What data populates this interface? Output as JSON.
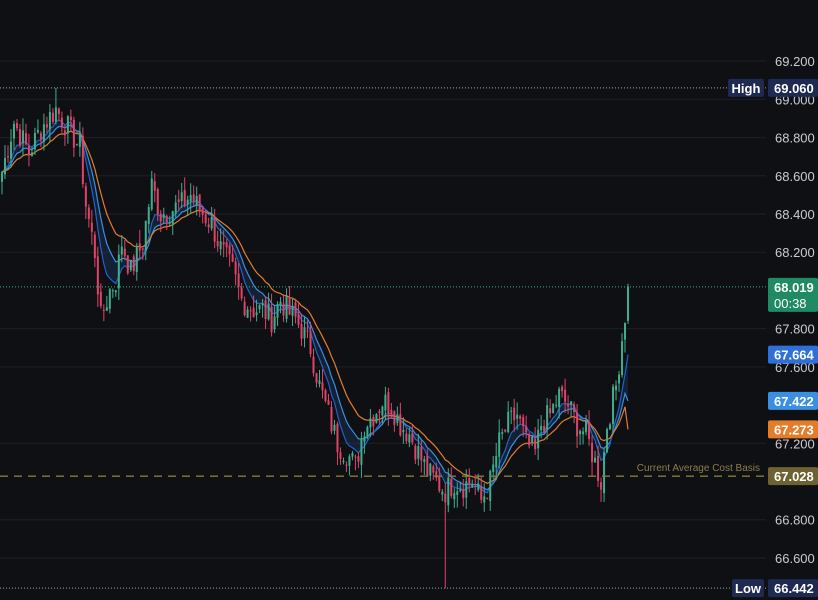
{
  "colors": {
    "background": "#0f1014",
    "grid": "#1d1f26",
    "up": "#3fae8c",
    "down": "#e0436a",
    "ma_fast": "#1e63c8",
    "ma_mid": "#3b8fe0",
    "ma_slow": "#e47c2a",
    "cost_basis": "#8a7a3a",
    "high_low_line": "#9ea4b5"
  },
  "chart_data": {
    "type": "candlestick",
    "y_ticks": [
      "69.200",
      "69.000",
      "68.800",
      "68.600",
      "68.400",
      "68.200",
      "67.800",
      "67.600",
      "67.200",
      "66.800",
      "66.600"
    ],
    "ylim": [
      66.38,
      69.52
    ],
    "high": {
      "label": "High",
      "value": "69.060"
    },
    "low": {
      "label": "Low",
      "value": "66.442"
    },
    "last": {
      "value": "68.019",
      "countdown": "00:38"
    },
    "ma_values": {
      "ma_fast": "67.664",
      "ma_mid": "67.422",
      "ma_slow": "67.273"
    },
    "cost_basis": {
      "label": "Current Average Cost Basis",
      "value": "67.028"
    },
    "candle_count": 210,
    "close_path": [
      [
        0,
        68.62
      ],
      [
        4,
        68.88
      ],
      [
        9,
        68.72
      ],
      [
        13,
        68.85
      ],
      [
        18,
        68.95
      ],
      [
        22,
        68.85
      ],
      [
        26,
        68.75
      ],
      [
        28,
        68.45
      ],
      [
        31,
        68.2
      ],
      [
        33,
        67.85
      ],
      [
        36,
        68.0
      ],
      [
        38,
        68.05
      ],
      [
        40,
        68.25
      ],
      [
        43,
        68.1
      ],
      [
        47,
        68.25
      ],
      [
        50,
        68.55
      ],
      [
        53,
        68.4
      ],
      [
        56,
        68.42
      ],
      [
        60,
        68.45
      ],
      [
        63,
        68.5
      ],
      [
        66,
        68.42
      ],
      [
        70,
        68.35
      ],
      [
        73,
        68.22
      ],
      [
        77,
        68.1
      ],
      [
        80,
        67.95
      ],
      [
        84,
        67.9
      ],
      [
        87,
        67.9
      ],
      [
        90,
        67.85
      ],
      [
        93,
        67.95
      ],
      [
        96,
        67.88
      ],
      [
        98,
        67.85
      ],
      [
        100,
        67.8
      ],
      [
        103,
        67.7
      ],
      [
        106,
        67.5
      ],
      [
        109,
        67.35
      ],
      [
        112,
        67.2
      ],
      [
        115,
        67.15
      ],
      [
        118,
        67.08
      ],
      [
        121,
        67.3
      ],
      [
        124,
        67.35
      ],
      [
        127,
        67.42
      ],
      [
        130,
        67.4
      ],
      [
        133,
        67.3
      ],
      [
        136,
        67.25
      ],
      [
        139,
        67.15
      ],
      [
        142,
        67.05
      ],
      [
        145,
        67.0
      ],
      [
        148,
        66.95
      ],
      [
        151,
        67.0
      ],
      [
        154,
        66.98
      ],
      [
        157,
        67.0
      ],
      [
        160,
        66.9
      ],
      [
        163,
        67.0
      ],
      [
        166,
        67.2
      ],
      [
        169,
        67.3
      ],
      [
        172,
        67.35
      ],
      [
        175,
        67.2
      ],
      [
        178,
        67.15
      ],
      [
        180,
        67.3
      ],
      [
        183,
        67.35
      ],
      [
        186,
        67.45
      ],
      [
        189,
        67.4
      ],
      [
        192,
        67.3
      ],
      [
        195,
        67.25
      ],
      [
        198,
        67.1
      ],
      [
        200,
        67.0
      ],
      [
        202,
        67.3
      ],
      [
        205,
        67.5
      ],
      [
        207,
        67.75
      ],
      [
        209,
        68.0
      ]
    ]
  }
}
